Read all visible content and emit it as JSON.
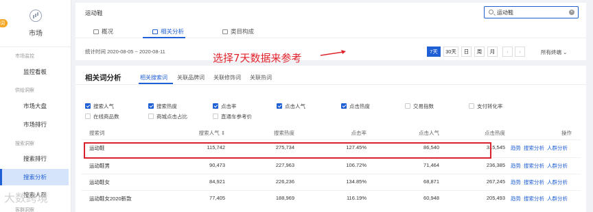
{
  "sidebar": {
    "logo_label": "市场",
    "badge": "词",
    "groups": [
      "市场监控",
      "供给洞察",
      "搜索洞察",
      "客群洞察"
    ],
    "items": [
      {
        "label": "监控看板",
        "active": false
      },
      {
        "label": "市场大盘",
        "active": false
      },
      {
        "label": "市场排行",
        "active": false
      },
      {
        "label": "搜索排行",
        "active": false
      },
      {
        "label": "搜索分析",
        "active": true
      },
      {
        "label": "搜索人群",
        "active": false
      }
    ]
  },
  "topcard": {
    "title": "运动鞋",
    "search_value": "运动鞋",
    "tabs": [
      {
        "label": "概况",
        "active": false
      },
      {
        "label": "相关分析",
        "active": true
      },
      {
        "label": "类目构成",
        "active": false
      }
    ],
    "stat_time": "统计时间 2020-08-05 ~ 2020-08-11",
    "date_buttons": [
      {
        "label": "7天",
        "active": true
      },
      {
        "label": "30天",
        "active": false
      },
      {
        "label": "日",
        "active": false
      },
      {
        "label": "周",
        "active": false
      },
      {
        "label": "月",
        "active": false
      },
      {
        "label": "‹",
        "active": false
      },
      {
        "label": "›",
        "active": false
      }
    ],
    "all_terminal": "所有终端 ⌄",
    "annotation": "选择7天数据来参考"
  },
  "analysis": {
    "title": "相关词分析",
    "subtabs": [
      {
        "label": "相关搜索词",
        "active": true
      },
      {
        "label": "关联品牌词",
        "active": false
      },
      {
        "label": "关联修饰词",
        "active": false
      },
      {
        "label": "关联热词",
        "active": false
      }
    ],
    "checkboxes": [
      {
        "label": "搜索人气",
        "checked": true
      },
      {
        "label": "搜索热度",
        "checked": true
      },
      {
        "label": "点击率",
        "checked": true
      },
      {
        "label": "点击人气",
        "checked": true
      },
      {
        "label": "点击热度",
        "checked": true
      },
      {
        "label": "交易指数",
        "checked": false
      },
      {
        "label": "支付转化率",
        "checked": false
      },
      {
        "label": "在线商品数",
        "checked": false
      },
      {
        "label": "商城点击占比",
        "checked": false
      },
      {
        "label": "直通车参考价",
        "checked": false
      }
    ],
    "columns": [
      "搜索词",
      "搜索人气 ⇕",
      "搜索热度",
      "点击率",
      "点击人气",
      "点击热度",
      "操作"
    ],
    "rows": [
      {
        "word": "运动鞋",
        "v1": "115,742",
        "v2": "275,734",
        "v3": "127.45%",
        "v4": "86,540",
        "v5": "315,545"
      },
      {
        "word": "运动鞋男",
        "v1": "90,473",
        "v2": "227,963",
        "v3": "106.72%",
        "v4": "71,464",
        "v5": "236,385"
      },
      {
        "word": "运动鞋女",
        "v1": "84,921",
        "v2": "226,236",
        "v3": "134.85%",
        "v4": "68,871",
        "v5": "267,245"
      },
      {
        "word": "运动鞋女2020新款",
        "v1": "77,405",
        "v2": "188,969",
        "v3": "116.19%",
        "v4": "60,948",
        "v5": "205,493"
      }
    ],
    "actions": [
      "趋势",
      "搜索分析",
      "人群分析"
    ]
  },
  "watermark": "大数跨境",
  "colors": {
    "accent": "#1f5fd6",
    "highlight": "#d9202a"
  }
}
